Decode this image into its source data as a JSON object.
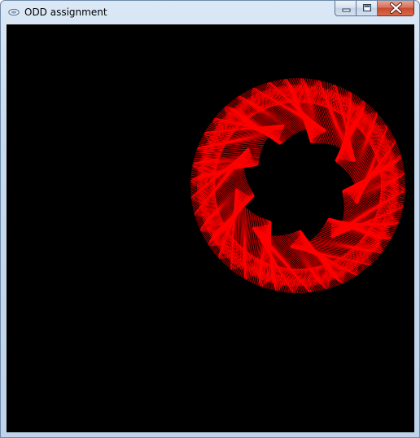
{
  "window": {
    "title": "ODD assignment",
    "frame_color": "#c9dbef",
    "caption_buttons": [
      {
        "name": "minimize",
        "icon": "minimize-icon"
      },
      {
        "name": "maximize",
        "icon": "maximize-icon"
      },
      {
        "name": "close",
        "icon": "close-icon"
      }
    ]
  },
  "canvas": {
    "background": "#000000",
    "stroke_color": "#ff0000",
    "figure": "spirograph-ring",
    "arms": 9
  }
}
